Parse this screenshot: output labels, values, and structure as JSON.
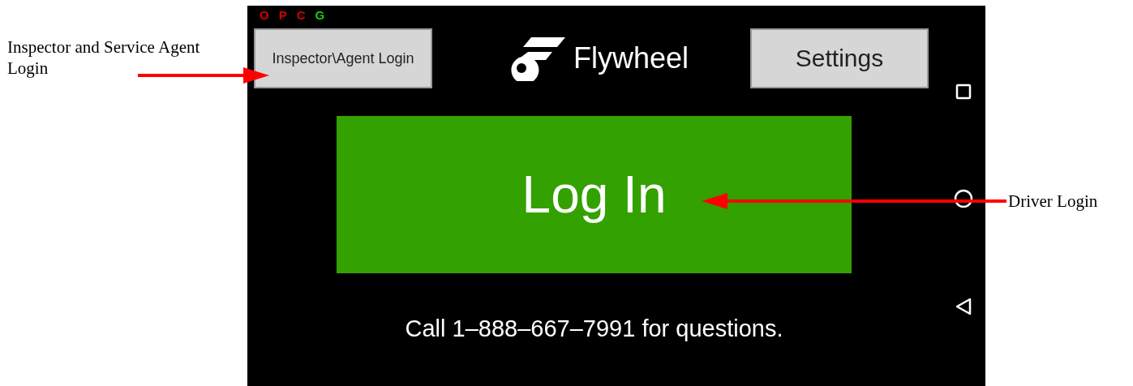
{
  "annotations": [
    {
      "text": "Inspector and Service Agent Login"
    },
    {
      "text": "Driver Login"
    }
  ],
  "status_indicators": [
    {
      "label": "O",
      "color": "#d40000"
    },
    {
      "label": "P",
      "color": "#d40000"
    },
    {
      "label": "C",
      "color": "#d40000"
    },
    {
      "label": "G",
      "color": "#19c819"
    }
  ],
  "inspector_button": {
    "label": "Inspector\\Agent Login"
  },
  "logo": {
    "text": "Flywheel"
  },
  "settings_button": {
    "label": "Settings"
  },
  "login_button": {
    "label": "Log In"
  },
  "help_text": "Call 1–888–667–7991 for questions."
}
